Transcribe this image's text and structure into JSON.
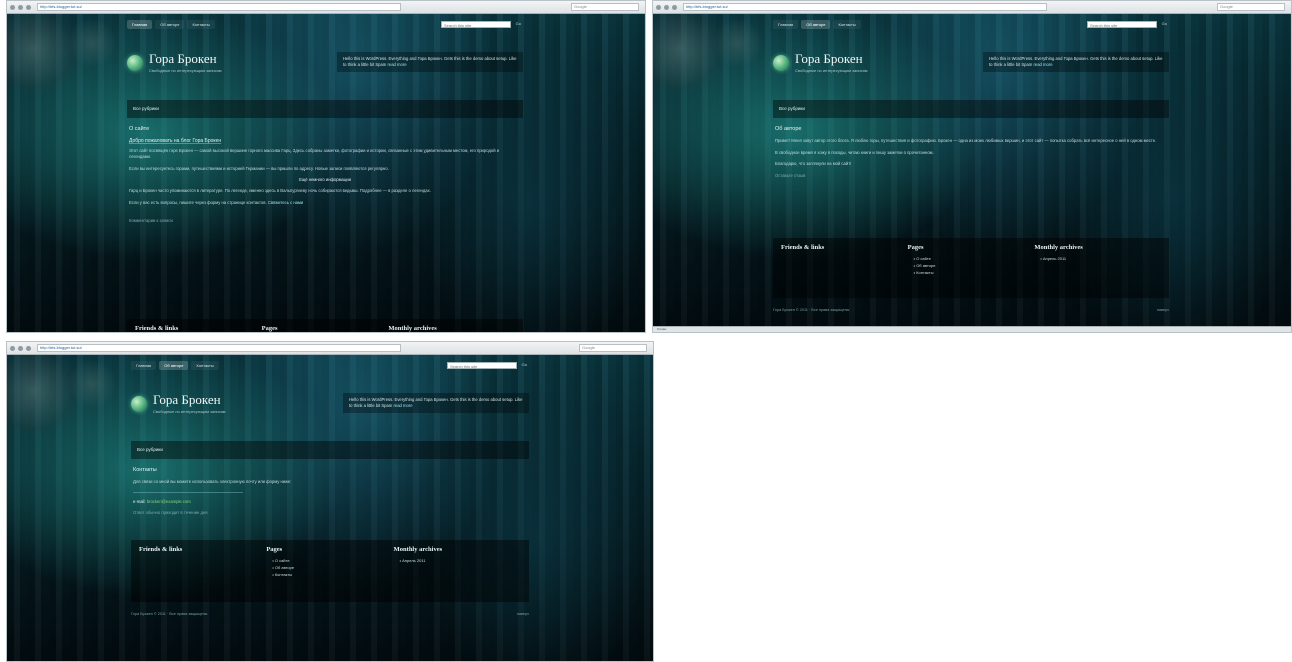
{
  "browser": {
    "url": "http://bfs-blogger.tut.su/",
    "search_placeholder": "Google",
    "status": "Готово"
  },
  "site": {
    "nav": [
      "Главная",
      "Об авторе",
      "Контакты"
    ],
    "search_placeholder": "Search this site",
    "search_go": "Go",
    "title": "Гора Брокен",
    "tagline": "Свободные по интересующим записям",
    "head_note": "Hello this is WordPress. Everything and Гора Брокен. Gets this is the demo about setup. Like to think a little bit Spam",
    "head_note_link": "read more",
    "menu_label": "Все рубрики",
    "footer": {
      "col1_title": "Friends & links",
      "col2_title": "Pages",
      "col2_items": [
        "О сайте",
        "Об авторе",
        "Контакты"
      ],
      "col3_title": "Monthly archives",
      "col3_items": [
        "Апрель 2011"
      ],
      "copyright": "Гора Брокен © 2011 · Все права защищены",
      "to_top": "наверх"
    }
  },
  "screen1": {
    "nav_active": 0,
    "page_title": "О сайте",
    "post_title": "Добро пожаловать на блог Гора Брокен",
    "p1": "Этот сайт посвящён горе Брокен — самой высокой вершине горного массива Гарц. Здесь собраны заметки, фотографии и истории, связанные с этим удивительным местом, его природой и легендами.",
    "p2": "Если вы интересуетесь горами, путешествиями и историей Германии — вы пришли по адресу. Новые записи появляются регулярно.",
    "center": "Ещё немного информации",
    "p3": "Гарц и Брокен часто упоминаются в литературе. По легенде, именно здесь в Вальпургиеву ночь собираются ведьмы. Подробнее — в разделе о легендах.",
    "p4": "Если у вас есть вопросы, пишите через форму на странице контактов.",
    "p4_link": "Свяжитесь с нами",
    "prev": "Комментарии к записи"
  },
  "screen2": {
    "nav_active": 1,
    "page_title": "Об авторе",
    "p1": "Привет! Меня зовут автор этого блога. Я люблю горы, путешествия и фотографию. Брокен — одна из моих любимых вершин, и этот сайт — попытка собрать всё интересное о ней в одном месте.",
    "p2": "В свободное время я хожу в походы, читаю книги и пишу заметки о прочитанном.",
    "p3": "Благодарю, что заглянули на мой сайт!",
    "link": "Оставьте отзыв"
  },
  "screen3": {
    "nav_active": 1,
    "page_title": "Контакты",
    "p1": "Для связи со мной вы можете использовать электронную почту или форму ниже:",
    "email_label": "e-mail:",
    "email_value": "brocken@example.com",
    "note": "Ответ обычно приходит в течение дня"
  }
}
